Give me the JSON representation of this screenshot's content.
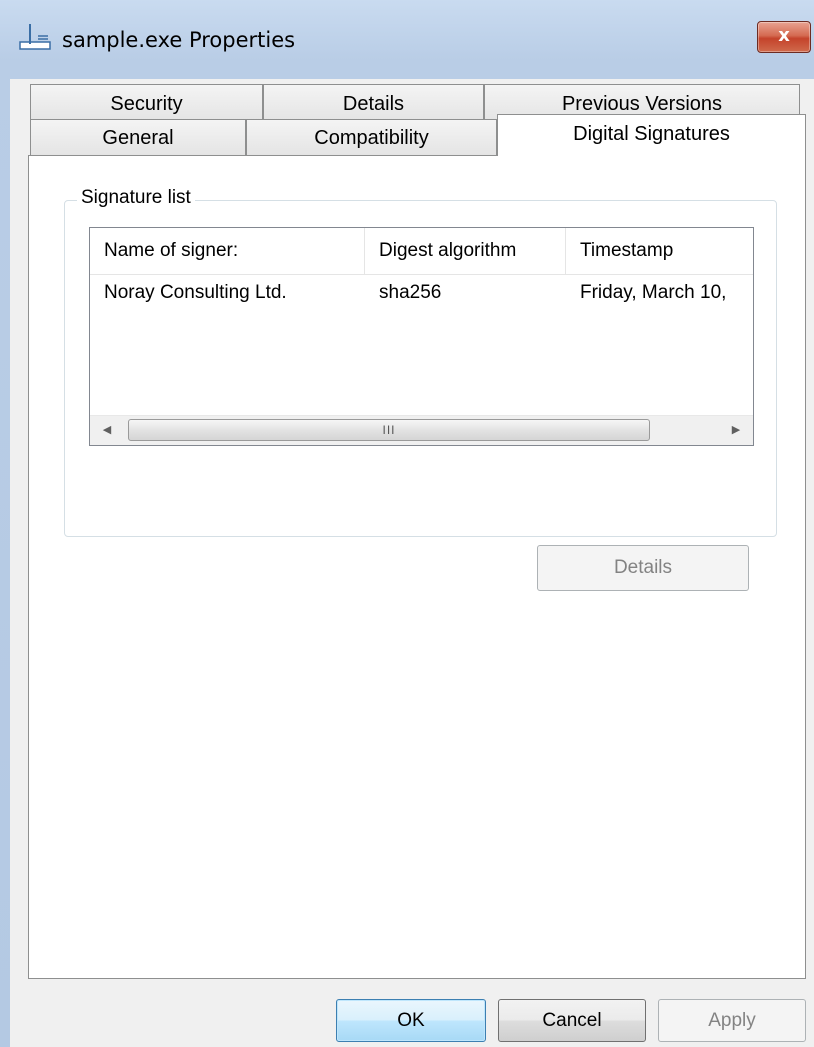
{
  "window": {
    "title": "sample.exe Properties",
    "close_label": "x"
  },
  "tabs": {
    "row1": [
      {
        "label": "Security"
      },
      {
        "label": "Details"
      },
      {
        "label": "Previous Versions"
      }
    ],
    "row2": [
      {
        "label": "General"
      },
      {
        "label": "Compatibility"
      },
      {
        "label": "Digital Signatures",
        "active": true
      }
    ]
  },
  "signature_list": {
    "legend": "Signature list",
    "columns": [
      "Name of signer:",
      "Digest algorithm",
      "Timestamp"
    ],
    "rows": [
      {
        "signer": "Noray Consulting Ltd.",
        "digest": "sha256",
        "timestamp": "Friday, March 10,"
      }
    ],
    "scrollbar": {
      "left_arrow": "◀",
      "right_arrow": "▶",
      "grip": "III"
    },
    "details_button": "Details"
  },
  "buttons": {
    "ok": "OK",
    "cancel": "Cancel",
    "apply": "Apply"
  }
}
